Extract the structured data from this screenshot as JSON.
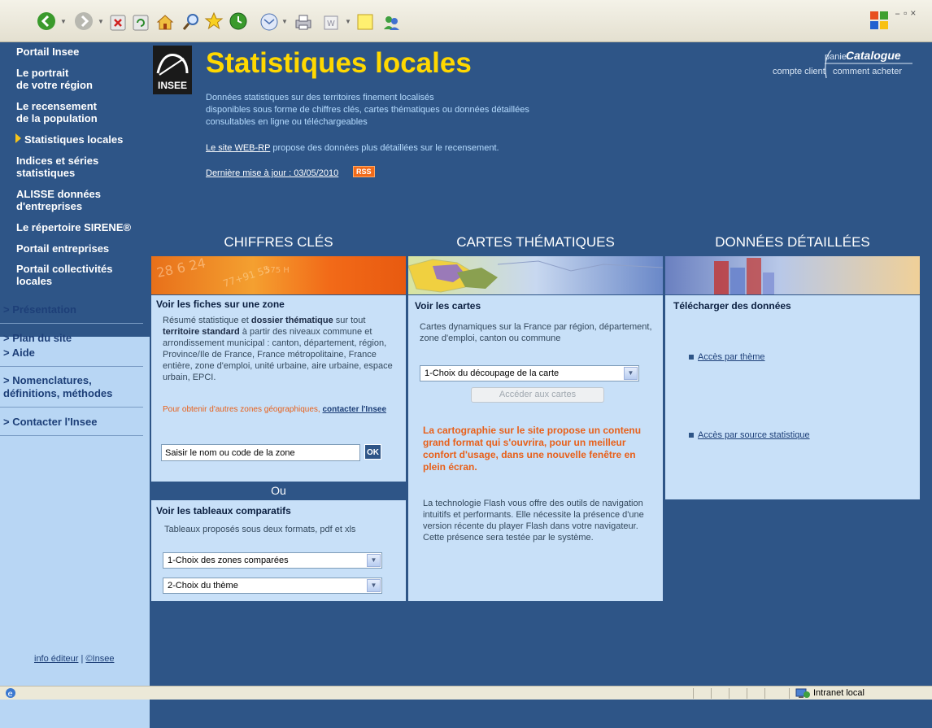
{
  "sidebar": {
    "nav_items": [
      {
        "label": "Portail Insee"
      },
      {
        "label": "Le portrait\nde votre région"
      },
      {
        "label": "Le recensement\nde la population"
      },
      {
        "label": "Statistiques locales"
      },
      {
        "label": "Indices et séries\nstatistiques"
      },
      {
        "label": "ALISSE données\nd'entreprises"
      },
      {
        "label": "Le répertoire SIRENE®"
      },
      {
        "label": "Portail entreprises"
      },
      {
        "label": "Portail collectivités\nlocales"
      }
    ],
    "secondary": {
      "presentation": "> Présentation",
      "plan": "> Plan du site",
      "aide": "> Aide",
      "nomenclatures": "> Nomenclatures,\ndéfinitions, méthodes",
      "contact": "> Contacter l'Insee"
    },
    "footer_info": "info éditeur",
    "footer_sep": "|",
    "footer_insee": "©Insee"
  },
  "header": {
    "logo_text": "INSEE",
    "title": "Statistiques locales",
    "description": "Données statistiques sur des territoires finement localisés\ndisponibles sous forme de chiffres clés, cartes thématiques ou données détaillées\nconsultables en ligne ou téléchargeables",
    "webrp_link": "Le site WEB-RP",
    "webrp_text": " propose des données plus détaillées sur le recensement.",
    "update": "Dernière mise à jour : 03/05/2010",
    "rss": "RSS",
    "panier": "panier",
    "catalogue": "Catalogue",
    "compte_client": "compte client",
    "comment_acheter": "comment acheter"
  },
  "columns": {
    "chiffres": "CHIFFRES CLÉS",
    "cartes": "CARTES THÉMATIQUES",
    "donnees": "DONNÉES DÉTAILLÉES"
  },
  "chiffres_panel": {
    "title": "Voir les fiches sur une zone",
    "text_a": "Résumé statistique et ",
    "text_b": "dossier thématique",
    "text_c": " sur tout ",
    "text_d": "territoire standard",
    "text_e": " à partir des niveaux commune et arrondissement municipal : canton, département, région, Province/Ile de France, France métropolitaine, France entière, zone d'emploi, unité urbaine, aire urbaine, espace urbain, EPCI.",
    "other_zones": "Pour obtenir d'autres zones géographiques, ",
    "contact_link": "contacter l'Insee",
    "search_value": "Saisir le nom ou code de la zone",
    "ok": "OK",
    "ou": "Ou",
    "tableaux_title": "Voir les tableaux comparatifs",
    "tableaux_text": "Tableaux proposés sous deux formats, pdf et xls",
    "select1": "1-Choix des zones comparées",
    "select2": "2-Choix du thème"
  },
  "cartes_panel": {
    "title": "Voir les cartes",
    "text": "Cartes dynamiques sur la France par région, département, zone d'emploi, canton ou commune",
    "select": "1-Choix du découpage de la carte",
    "button": "Accéder aux cartes",
    "orange_text": "La cartographie sur le site propose un contenu grand format qui s'ouvrira, pour un meilleur confort d'usage, dans une nouvelle fenêtre en plein écran.",
    "flash_text": "La technologie Flash vous offre des outils de navigation intuitifs et performants. Elle nécessite la présence d'une version récente du player Flash dans votre navigateur. Cette présence sera testée par le système."
  },
  "donnees_panel": {
    "title": "Télécharger des données",
    "link1": "Accès par thème",
    "link2": "Accès par source statistique"
  },
  "status": {
    "zone": "Intranet local"
  },
  "colors": {
    "background": "#2e5587",
    "title": "#ffd800",
    "orange": "#e8601a",
    "panel": "#c8e0f8"
  }
}
